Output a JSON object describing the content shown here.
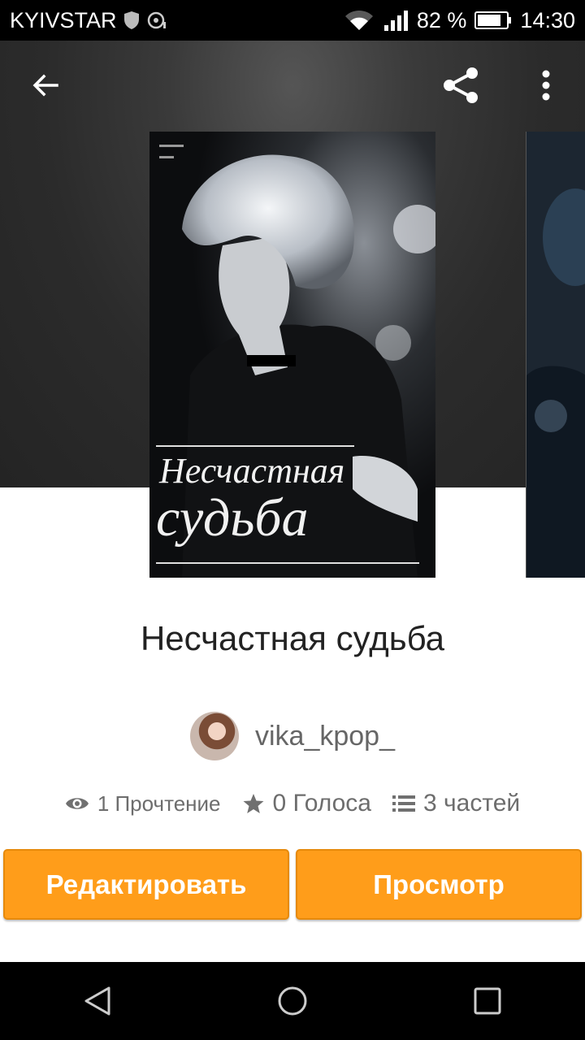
{
  "status_bar": {
    "carrier": "KYIVSTAR",
    "battery": "82 %",
    "time": "14:30"
  },
  "cover": {
    "title_line1": "Несчастная",
    "title_line2": "судьба"
  },
  "story": {
    "title": "Несчастная судьба",
    "author": "vika_kpop_"
  },
  "stats": {
    "reads": "1 Прочтение",
    "votes": "0 Голоса",
    "parts": "3 частей"
  },
  "buttons": {
    "edit": "Редактировать",
    "view": "Просмотр"
  },
  "colors": {
    "accent": "#ff9d1a",
    "status_bar": "#000000"
  },
  "icons": [
    "back-arrow-icon",
    "share-icon",
    "more-vert-icon",
    "eye-icon",
    "star-icon",
    "list-icon",
    "nav-back-icon",
    "nav-home-icon",
    "nav-recents-icon",
    "wifi-icon",
    "signal-icon",
    "battery-icon"
  ]
}
